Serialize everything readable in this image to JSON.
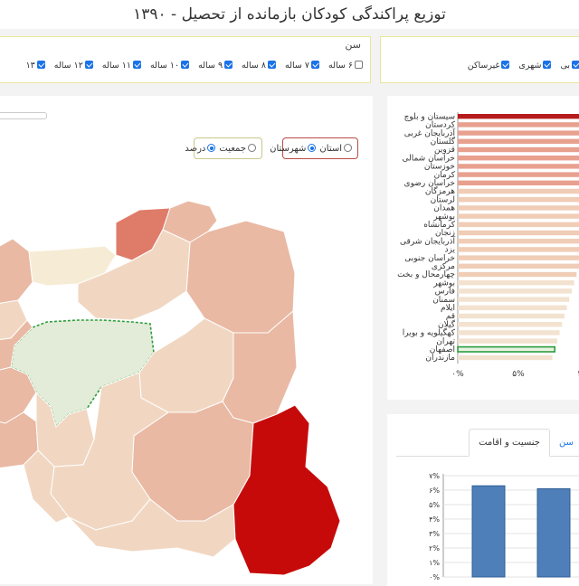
{
  "page": {
    "title": "توزیع پراکندگی کودکان بازمانده از تحصیل - ۱۳۹۰"
  },
  "age_filter": {
    "label": "سن",
    "options": [
      {
        "label": "۶ ساله",
        "checked": false
      },
      {
        "label": "۷ ساله",
        "checked": true
      },
      {
        "label": "۸ ساله",
        "checked": true
      },
      {
        "label": "۹ ساله",
        "checked": true
      },
      {
        "label": "۱۰ ساله",
        "checked": true
      },
      {
        "label": "۱۱ ساله",
        "checked": true
      },
      {
        "label": "۱۲ ساله",
        "checked": true
      },
      {
        "label": "۱۳",
        "checked": true
      }
    ]
  },
  "residence_filter": {
    "options": [
      {
        "label": "بی",
        "checked": true
      },
      {
        "label": "شهری",
        "checked": true
      },
      {
        "label": "غیرساکن",
        "checked": true
      }
    ]
  },
  "map_controls": {
    "level": {
      "options": [
        {
          "label": "استان",
          "selected": false
        },
        {
          "label": "شهرستان",
          "selected": true
        }
      ]
    },
    "metric": {
      "options": [
        {
          "label": "جمعیت",
          "selected": false
        },
        {
          "label": "درصد",
          "selected": true
        }
      ]
    }
  },
  "map": {
    "colors": {
      "dark": "#c60a0a",
      "mid": "#de7c69",
      "light": "#e9b9a4",
      "pale": "#f1d7c2",
      "cream": "#f6ecd6",
      "highlight": "#e3ecd8",
      "highlight_border": "#2e9d3c"
    }
  },
  "bar_chart": {
    "chart_data": {
      "type": "bar",
      "orientation": "horizontal",
      "categories": [
        "سیستان و بلوچ",
        "کردستان",
        "آذربایجان غربی",
        "گلستان",
        "قزوین",
        "خراسان شمالی",
        "خوزستان",
        "کرمان",
        "خراسان رضوی",
        "هرمزگان",
        "لرستان",
        "همدان",
        "بوشهر",
        "کرمانشاه",
        "زنجان",
        "آذربایجان شرقی",
        "یزد",
        "خراسان جنوبی",
        "مرکزی",
        "چهارمحال و بخت",
        "بوشهر",
        "فارس",
        "سمنان",
        "ایلام",
        "قم",
        "گیلان",
        "کهگیلویه و بویرا",
        "تهران",
        "اصفهان",
        "مازندران"
      ],
      "values": [
        13.5,
        13.4,
        13.2,
        13.0,
        12.8,
        12.6,
        12.4,
        12.2,
        12.0,
        11.8,
        11.6,
        11.4,
        11.2,
        11.0,
        10.8,
        10.6,
        10.4,
        10.2,
        10.0,
        9.8,
        9.6,
        9.4,
        9.2,
        9.0,
        8.8,
        8.6,
        8.4,
        8.2,
        8.0,
        7.8
      ],
      "x_tick_labels": [
        "۰%",
        "۵%",
        "۱"
      ],
      "highlight_index": 28,
      "colors": {
        "top": "#b71c1c",
        "high": "#e8a08f",
        "mid": "#f0cdb6",
        "low": "#f2e2cf",
        "highlight": "#2e9d3c"
      }
    }
  },
  "age_chart": {
    "tabs": [
      {
        "label": "سن",
        "active": true
      },
      {
        "label": "جنسیت و اقامت",
        "active": false
      }
    ],
    "chart_data": {
      "type": "bar",
      "y_tick_labels": [
        "۰%",
        "۱%",
        "۲%",
        "۳%",
        "۴%",
        "۵%",
        "۶%",
        "۷%"
      ],
      "ylim": [
        0,
        7
      ],
      "values": [
        6.3,
        6.1
      ],
      "color": "#4e7fb8"
    }
  }
}
